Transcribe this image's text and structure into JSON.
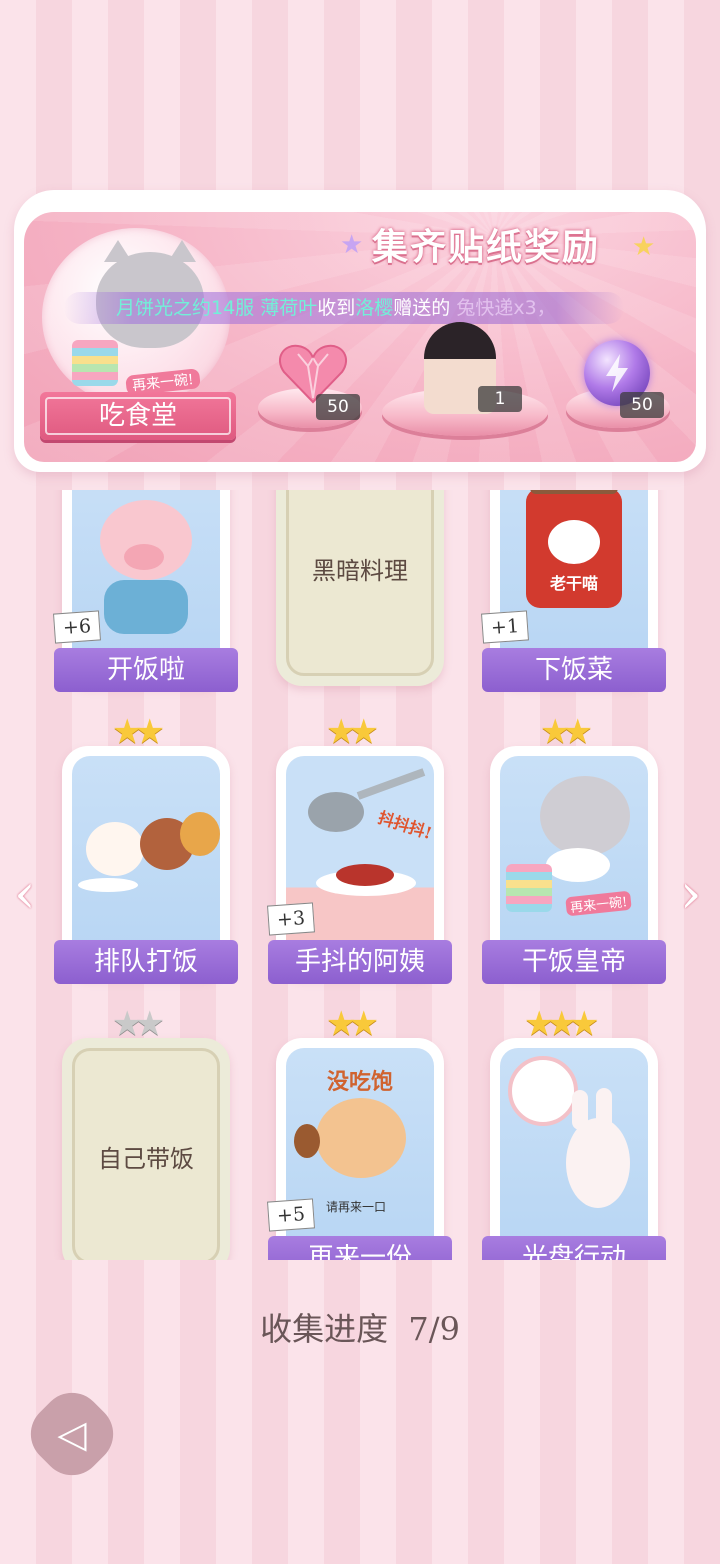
{
  "banner": {
    "title": "集齐贴纸奖励",
    "ticker": {
      "part1": "月饼光之约14服",
      "name1": "薄荷叶",
      "mid1": "收到",
      "name2": "洛樱",
      "mid2": "赠送的",
      "item": "兔快递x3",
      "end": "，"
    },
    "cafe": {
      "label": "吃食堂",
      "bubble_text": "再来一碗!"
    },
    "rewards": [
      {
        "name": "heart-gem",
        "count": "50"
      },
      {
        "name": "portrait",
        "count": "1"
      },
      {
        "name": "energy-orb",
        "count": "50"
      }
    ]
  },
  "cards": [
    {
      "label": "开饭啦",
      "bonus": "+6",
      "locked": false,
      "stars": ""
    },
    {
      "label": "黑暗料理",
      "bonus": "",
      "locked": true,
      "stars": ""
    },
    {
      "label": "下饭菜",
      "bonus": "+1",
      "locked": false,
      "stars": "",
      "jar_text": "老干喵"
    },
    {
      "label": "排队打饭",
      "bonus": "",
      "locked": false,
      "stars": "★★"
    },
    {
      "label": "手抖的阿姨",
      "bonus": "+3",
      "locked": false,
      "stars": "★★",
      "art_text": "抖抖抖!"
    },
    {
      "label": "干饭皇帝",
      "bonus": "",
      "locked": false,
      "stars": "★★",
      "art_text": "再来一碗!"
    },
    {
      "label": "自己带饭",
      "bonus": "",
      "locked": true,
      "stars": "★★"
    },
    {
      "label": "再来一份",
      "bonus": "+5",
      "locked": false,
      "stars": "★★",
      "art_text": "没吃饱",
      "art_text2": "请再来一口"
    },
    {
      "label": "光盘行动",
      "bonus": "",
      "locked": false,
      "stars": "★★★"
    }
  ],
  "progress": {
    "label": "收集进度",
    "value": "7/9"
  },
  "nav": {
    "prev": "‹",
    "next": "›",
    "back": "◁"
  },
  "colors": {
    "label_purple": "#9a6cd8",
    "banner_pink": "#f4aabd",
    "star_gold": "#f9c93a"
  }
}
